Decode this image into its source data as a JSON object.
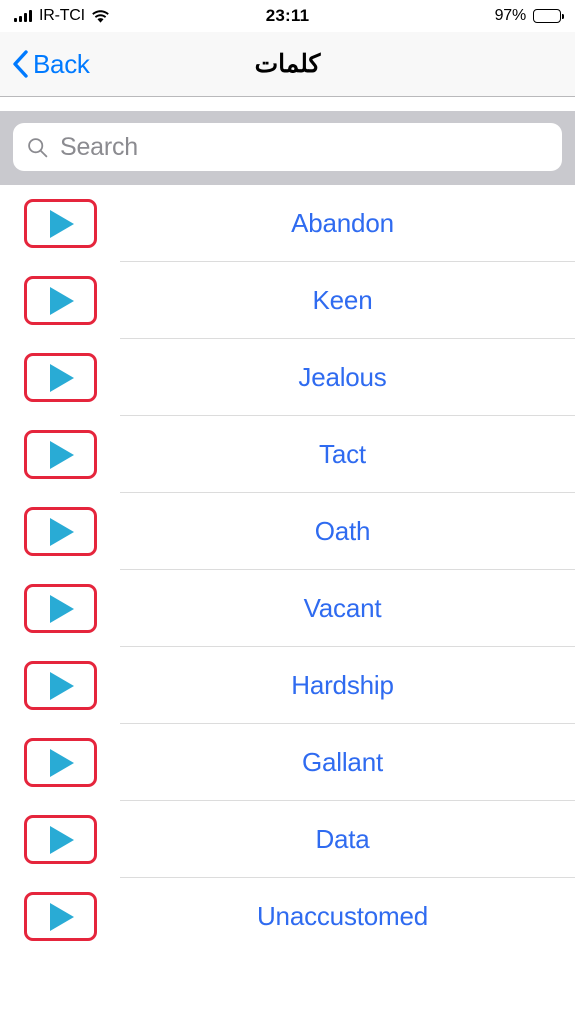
{
  "status_bar": {
    "signal_icon": "signal-bars-icon",
    "carrier": "IR-TCI",
    "wifi_icon": "wifi-icon",
    "time": "23:11",
    "battery_percent": "97%",
    "battery_icon": "battery-icon",
    "battery_level": 97
  },
  "nav_bar": {
    "back_icon": "chevron-left-icon",
    "back_label": "Back",
    "title": "كلمات"
  },
  "search": {
    "icon": "search-icon",
    "placeholder": "Search",
    "value": ""
  },
  "colors": {
    "accent_blue": "#007aff",
    "word_blue": "#2f6bf0",
    "play_border_red": "#e5253c",
    "play_triangle_cyan": "#29abd5",
    "search_band_gray": "#c9c9ce",
    "navbar_gray": "#f8f8f8",
    "separator_gray": "#dcdcdc"
  },
  "list": {
    "play_icon": "play-icon",
    "items": [
      {
        "word": "Abandon"
      },
      {
        "word": "Keen"
      },
      {
        "word": "Jealous"
      },
      {
        "word": "Tact"
      },
      {
        "word": "Oath"
      },
      {
        "word": "Vacant"
      },
      {
        "word": "Hardship"
      },
      {
        "word": "Gallant"
      },
      {
        "word": "Data"
      },
      {
        "word": "Unaccustomed"
      }
    ]
  }
}
